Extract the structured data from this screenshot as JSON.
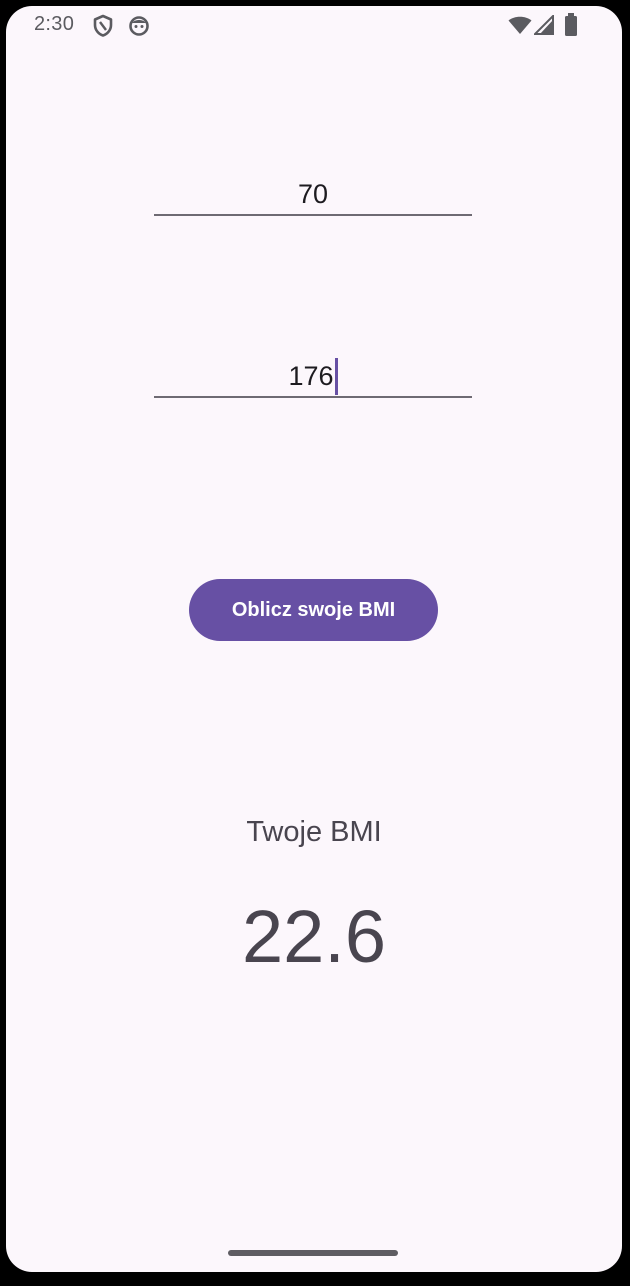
{
  "status_bar": {
    "time": "2:30",
    "icons": [
      "shield-icon",
      "face-icon",
      "wifi-icon",
      "signal-icon",
      "battery-icon"
    ],
    "icon_color": "#5b5b60"
  },
  "form": {
    "weight_value": "70",
    "height_value": "176"
  },
  "button": {
    "label": "Oblicz swoje BMI",
    "color": "#6750a4"
  },
  "result": {
    "label": "Twoje BMI",
    "value": "22.6"
  },
  "colors": {
    "background": "#fcf7fc",
    "accent": "#6750a4",
    "text": "#49454f"
  }
}
